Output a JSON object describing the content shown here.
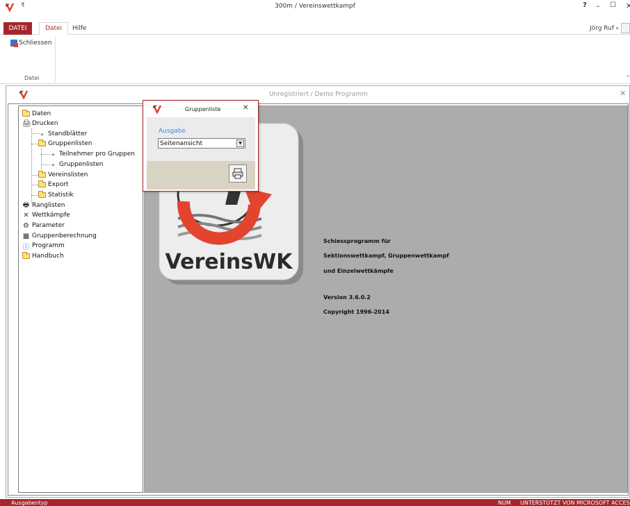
{
  "window": {
    "title": "300m / Vereinswettkampf",
    "help_label": "?",
    "min_label": "–",
    "max_label": "☐",
    "close_label": "✕"
  },
  "ribbon": {
    "tabs": [
      "DATEI",
      "Datei",
      "Hilfe"
    ],
    "active_tab": "Datei",
    "user": "Jörg Ruf",
    "close_button_label": "Schliessen",
    "group_label": "Datei",
    "collapse_label": "^"
  },
  "main_window": {
    "title": "Unregistriert  /  Demo Programm",
    "close_label": "✕"
  },
  "tree": {
    "items": [
      {
        "label": "Daten",
        "icon": "folder-icon"
      },
      {
        "label": "Drucken",
        "icon": "printer-icon"
      },
      {
        "label": "Standblätter",
        "icon": "chevron-icon"
      },
      {
        "label": "Gruppenlisten",
        "icon": "folder-icon"
      },
      {
        "label": "Teilnehmer pro Gruppen",
        "icon": "chevron-icon"
      },
      {
        "label": "Gruppenlisten",
        "icon": "chevron-icon"
      },
      {
        "label": "Vereinslisten",
        "icon": "folder-icon"
      },
      {
        "label": "Export",
        "icon": "folder-icon"
      },
      {
        "label": "Statistik",
        "icon": "folder-icon"
      },
      {
        "label": "Ranglisten",
        "icon": "ranking-icon"
      },
      {
        "label": "Wettkämpfe",
        "icon": "crossed-rifles-icon"
      },
      {
        "label": "Parameter",
        "icon": "parameters-icon"
      },
      {
        "label": "Gruppenberechnung",
        "icon": "calculator-icon"
      },
      {
        "label": "Programm",
        "icon": "info-icon"
      },
      {
        "label": "Handbuch",
        "icon": "folder-icon"
      }
    ]
  },
  "content": {
    "logo_text": "VereinsWK",
    "lines": [
      "Schiessprogramm für",
      "Sektionswettkampf, Gruppenwettkampf",
      "und Einzelwettkämpfe",
      "Version 3.6.0.2",
      "Copyright  1996-2014"
    ]
  },
  "dialog": {
    "title": "Gruppenliste",
    "close_label": "✕",
    "field_label": "Ausgabe",
    "select_value": "Seitenansicht",
    "dropdown_arrow": "▼"
  },
  "status": {
    "left": "Ausgabentyp",
    "num": "NUM",
    "right": "UNTERSTÜTZT VON MICROSOFT ACCESS"
  },
  "colors": {
    "accent": "#a4262c",
    "content_gray": "#acacac",
    "dialog_footer": "#d9d3c4",
    "link_blue": "#3b8bd5"
  }
}
